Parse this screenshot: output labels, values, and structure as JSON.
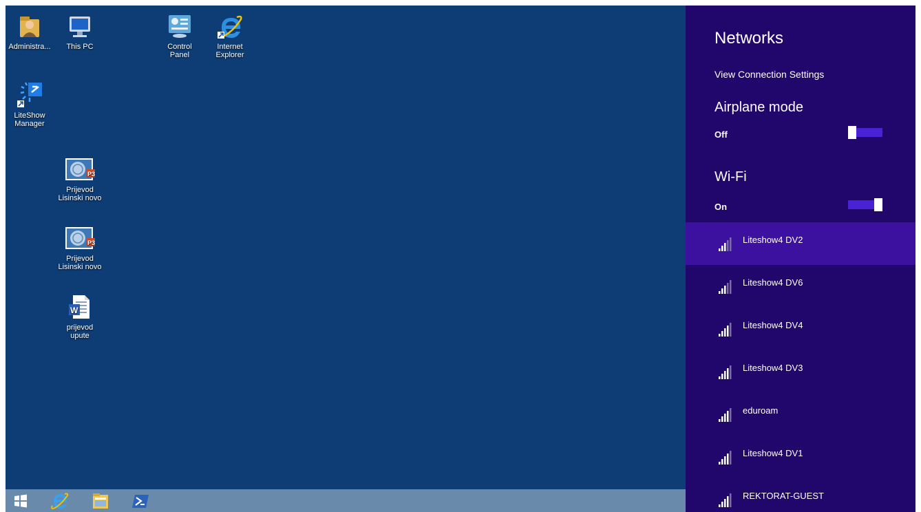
{
  "desktop": {
    "icons": [
      {
        "label": "Administra...",
        "icon": "user-folder-icon"
      },
      {
        "label": "This PC",
        "icon": "computer-icon"
      },
      {
        "label": "Control\nPanel",
        "icon": "control-panel-icon"
      },
      {
        "label": "Internet\nExplorer",
        "icon": "internet-explorer-icon"
      },
      {
        "label": "LiteShow\nManager",
        "icon": "liteshow-icon"
      },
      {
        "label": "Prijevod\nLisinski novo",
        "icon": "powerpoint-file-icon"
      },
      {
        "label": "Prijevod\nLisinski novo",
        "icon": "powerpoint-file-icon"
      },
      {
        "label": "prijevod\nupute",
        "icon": "word-file-icon"
      }
    ]
  },
  "taskbar": {
    "items": [
      "start-icon",
      "internet-explorer-icon",
      "file-explorer-icon",
      "powershell-icon"
    ]
  },
  "panel": {
    "title": "Networks",
    "view_settings": "View Connection Settings",
    "airplane": {
      "heading": "Airplane mode",
      "state": "Off",
      "on": false
    },
    "wifi": {
      "heading": "Wi-Fi",
      "state": "On",
      "on": true
    },
    "networks": [
      {
        "name": "Liteshow4 DV2",
        "bars": 3,
        "selected": true
      },
      {
        "name": "Liteshow4 DV6",
        "bars": 3,
        "selected": false
      },
      {
        "name": "Liteshow4 DV4",
        "bars": 4,
        "selected": false
      },
      {
        "name": "Liteshow4 DV3",
        "bars": 4,
        "selected": false
      },
      {
        "name": "eduroam",
        "bars": 4,
        "selected": false
      },
      {
        "name": "Liteshow4 DV1",
        "bars": 4,
        "selected": false
      },
      {
        "name": "REKTORAT-GUEST",
        "bars": 4,
        "selected": false
      }
    ]
  },
  "colors": {
    "desktop": "#0e3d75",
    "panel": "#21076b",
    "selected_row": "#3d11a0",
    "toggle_track": "#4a22d6",
    "taskbar": "#6a8aab"
  }
}
